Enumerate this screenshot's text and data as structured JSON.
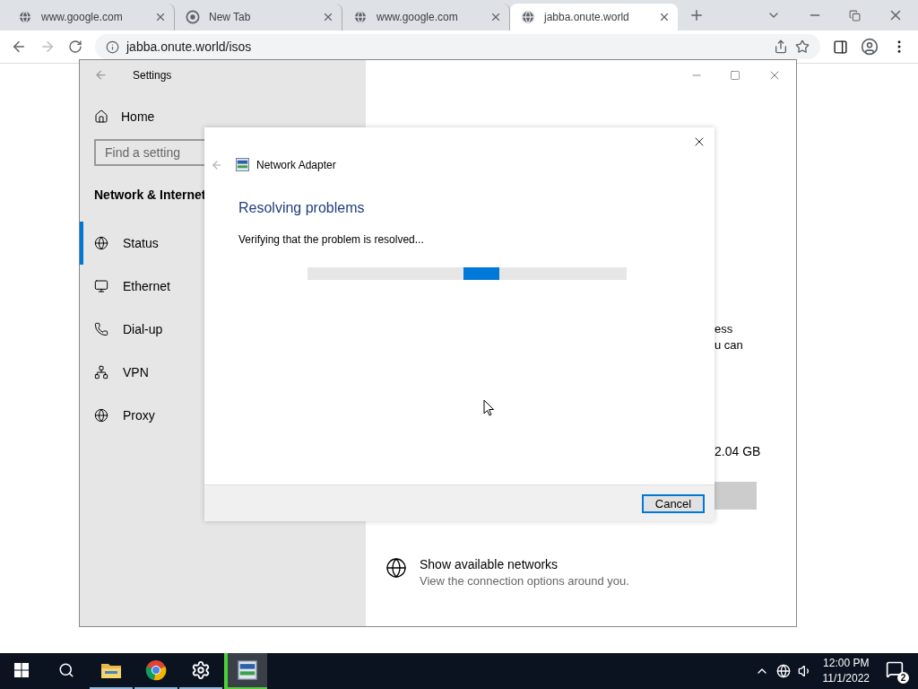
{
  "browser": {
    "tabs": [
      {
        "title": "www.google.com",
        "kind": "globe",
        "selected": false
      },
      {
        "title": "New Tab",
        "kind": "chrome",
        "selected": false
      },
      {
        "title": "www.google.com",
        "kind": "globe",
        "selected": false
      },
      {
        "title": "jabba.onute.world",
        "kind": "globe",
        "selected": true
      }
    ],
    "address": "jabba.onute.world/isos"
  },
  "settings": {
    "title": "Settings",
    "home": "Home",
    "search_placeholder": "Find a setting",
    "section": "Network & Internet",
    "nav": [
      {
        "label": "Status",
        "kind": "status",
        "selected": true
      },
      {
        "label": "Ethernet",
        "kind": "ethernet",
        "selected": false
      },
      {
        "label": "Dial-up",
        "kind": "dialup",
        "selected": false
      },
      {
        "label": "VPN",
        "kind": "vpn",
        "selected": false
      },
      {
        "label": "Proxy",
        "kind": "proxy",
        "selected": false
      }
    ],
    "fragments": [
      "ess",
      "u can"
    ],
    "data_usage": "2.04 GB",
    "link": {
      "title": "Show available networks",
      "description": "View the connection options around you."
    }
  },
  "dialog": {
    "title": "Network Adapter",
    "heading": "Resolving problems",
    "message": "Verifying that the problem is resolved...",
    "progress": {
      "level": 0.6
    },
    "cancel": {
      "label": "Cancel",
      "default": true
    }
  },
  "taskbar": {
    "apps": [
      {
        "kind": "explorer",
        "open": true,
        "active": false
      },
      {
        "kind": "chrome",
        "open": true,
        "active": false
      },
      {
        "kind": "settings",
        "open": true,
        "active": false
      },
      {
        "kind": "adapter",
        "open": true,
        "active": true
      }
    ],
    "time": "12:00 PM",
    "date": "11/1/2022",
    "notifications": "2"
  }
}
